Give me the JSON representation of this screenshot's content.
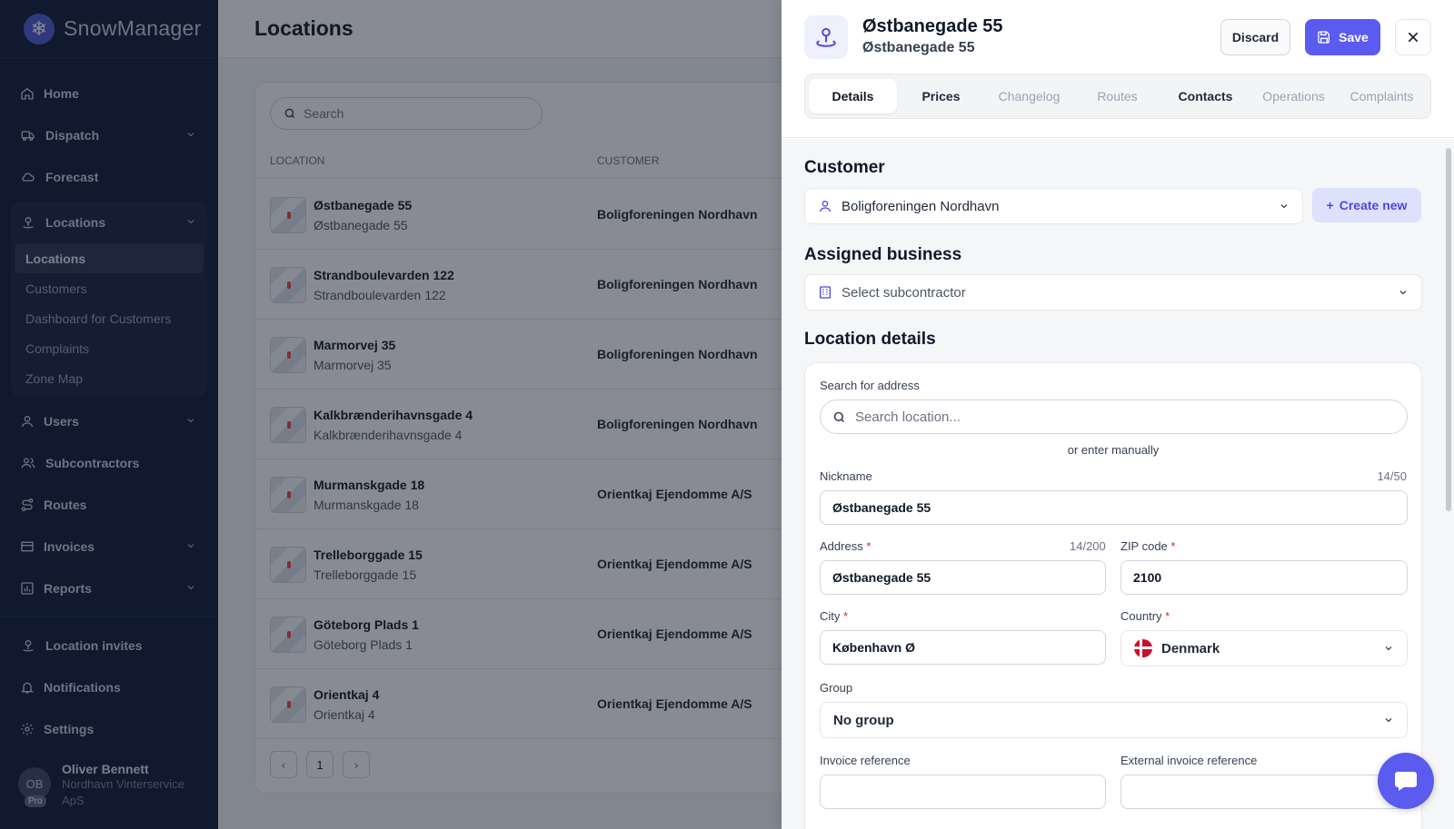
{
  "app": {
    "name": "SnowManager"
  },
  "sidebar": {
    "items": [
      {
        "label": "Home",
        "icon": "home-icon"
      },
      {
        "label": "Dispatch",
        "icon": "truck-icon"
      },
      {
        "label": "Forecast",
        "icon": "cloud-icon"
      },
      {
        "label": "Locations",
        "icon": "map-pin-icon"
      }
    ],
    "locations_sub": [
      "Locations",
      "Customers",
      "Dashboard for Customers",
      "Complaints",
      "Zone Map"
    ],
    "items2": [
      {
        "label": "Users",
        "icon": "user-icon"
      },
      {
        "label": "Subcontractors",
        "icon": "users-icon"
      },
      {
        "label": "Routes",
        "icon": "route-icon"
      },
      {
        "label": "Invoices",
        "icon": "invoice-icon"
      },
      {
        "label": "Reports",
        "icon": "chart-icon"
      }
    ],
    "bottom": [
      {
        "label": "Location invites",
        "icon": "map-pin-icon"
      },
      {
        "label": "Notifications",
        "icon": "bell-icon"
      },
      {
        "label": "Settings",
        "icon": "gear-icon"
      }
    ],
    "user": {
      "initials": "OB",
      "badge": "Pro",
      "name": "Oliver Bennett",
      "org": "Nordhavn Vinterservice ApS"
    }
  },
  "main": {
    "title": "Locations",
    "search_placeholder": "Search",
    "columns": {
      "location": "LOCATION",
      "customer": "CUSTOMER"
    },
    "rows": [
      {
        "title": "Østbanegade 55",
        "sub": "Østbanegade 55",
        "customer": "Boligforeningen Nordhavn"
      },
      {
        "title": "Strandboulevarden 122",
        "sub": "Strandboulevarden 122",
        "customer": "Boligforeningen Nordhavn"
      },
      {
        "title": "Marmorvej 35",
        "sub": "Marmorvej 35",
        "customer": "Boligforeningen Nordhavn"
      },
      {
        "title": "Kalkbrænderihavnsgade 4",
        "sub": "Kalkbrænderihavnsgade 4",
        "customer": "Boligforeningen Nordhavn"
      },
      {
        "title": "Murmanskgade 18",
        "sub": "Murmanskgade 18",
        "customer": "Orientkaj Ejendomme A/S"
      },
      {
        "title": "Trelleborggade 15",
        "sub": "Trelleborggade 15",
        "customer": "Orientkaj Ejendomme A/S"
      },
      {
        "title": "Göteborg Plads 1",
        "sub": "Göteborg Plads 1",
        "customer": "Orientkaj Ejendomme A/S"
      },
      {
        "title": "Orientkaj 4",
        "sub": "Orientkaj 4",
        "customer": "Orientkaj Ejendomme A/S"
      }
    ],
    "pager": {
      "prev": "‹",
      "page": "1",
      "next": "›"
    }
  },
  "drawer": {
    "title": "Østbanegade 55",
    "subtitle": "Østbanegade 55",
    "discard": "Discard",
    "save": "Save",
    "tabs": [
      "Details",
      "Prices",
      "Changelog",
      "Routes",
      "Contacts",
      "Operations",
      "Complaints"
    ],
    "customer_section": "Customer",
    "customer_value": "Boligforeningen Nordhavn",
    "create_new": "Create new",
    "business_section": "Assigned business",
    "business_placeholder": "Select subcontractor",
    "details_section": "Location details",
    "search_address_label": "Search for address",
    "search_address_placeholder": "Search location...",
    "or_manual": "or enter manually",
    "nickname": {
      "label": "Nickname",
      "counter": "14/50",
      "value": "Østbanegade 55"
    },
    "address": {
      "label": "Address",
      "counter": "14/200",
      "value": "Østbanegade 55"
    },
    "zip": {
      "label": "ZIP code",
      "value": "2100"
    },
    "city": {
      "label": "City",
      "value": "København Ø"
    },
    "country": {
      "label": "Country",
      "value": "Denmark"
    },
    "group": {
      "label": "Group",
      "value": "No group"
    },
    "invoice_ref": {
      "label": "Invoice reference",
      "value": ""
    },
    "ext_invoice_ref": {
      "label": "External invoice reference",
      "value": ""
    },
    "required_mark": "*"
  },
  "colors": {
    "accent": "#5b5bf0",
    "sidebar_bg": "#0f1b33"
  }
}
